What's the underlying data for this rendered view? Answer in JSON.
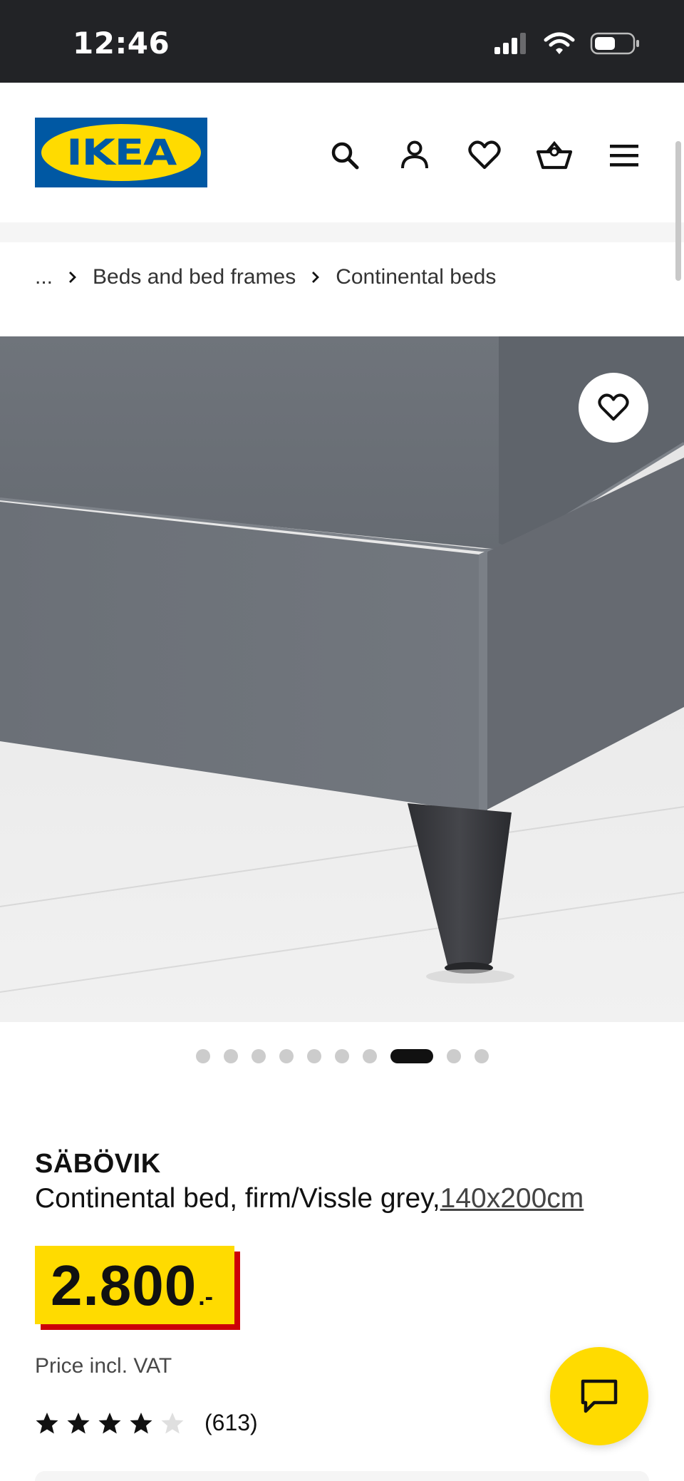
{
  "status_bar": {
    "time": "12:46"
  },
  "header": {
    "logo_text": "IKEA",
    "icons": [
      "search-icon",
      "account-icon",
      "heart-icon",
      "cart-icon",
      "menu-icon"
    ]
  },
  "breadcrumb": {
    "items": [
      "...",
      "Beds and bed frames",
      "Continental beds"
    ]
  },
  "carousel": {
    "dot_count": 10,
    "active_index": 7
  },
  "product": {
    "name": "SÄBÖVIK",
    "description": "Continental bed, firm/Vissle grey,",
    "size_link": "140x200cm",
    "price_integer": "2.800",
    "price_suffix": ".-",
    "price_note": "Price incl. VAT",
    "rating": 4,
    "rating_max": 5,
    "review_count": "(613)"
  },
  "colors": {
    "ikea_blue": "#0058a3",
    "ikea_yellow": "#ffdb00",
    "price_red": "#cc0008",
    "status_bar_bg": "#222326"
  }
}
